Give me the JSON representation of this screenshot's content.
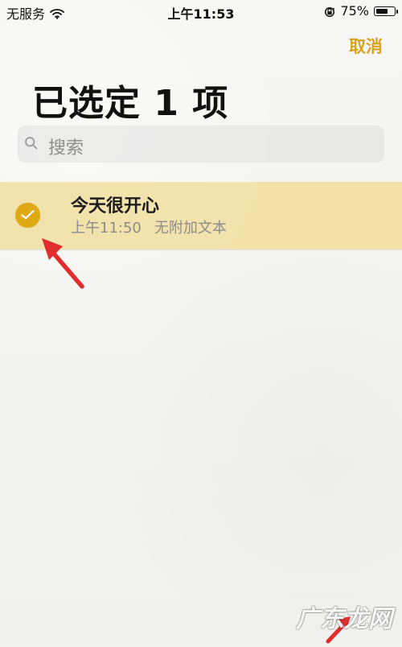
{
  "status_bar": {
    "carrier": "无服务",
    "time": "上午11:53",
    "battery_text": "75%",
    "battery_level": 0.75,
    "icons": {
      "wifi": "wifi-icon",
      "lock": "orientation-lock-icon",
      "battery": "battery-icon"
    }
  },
  "header": {
    "cancel_label": "取消",
    "title": "已选定 1 项"
  },
  "search": {
    "placeholder": "搜索",
    "icon": "search-icon"
  },
  "selected_note": {
    "title": "今天很开心",
    "time": "上午11:50",
    "subtitle": "无附加文本",
    "selected": true,
    "icon": "check-circle-icon"
  },
  "overlay": {
    "watermark": "广东龙网"
  },
  "colors": {
    "accent": "#d6a31d",
    "selection_bg": "#f1dc96",
    "check": "#e0a914",
    "arrow": "#e12d2d"
  }
}
